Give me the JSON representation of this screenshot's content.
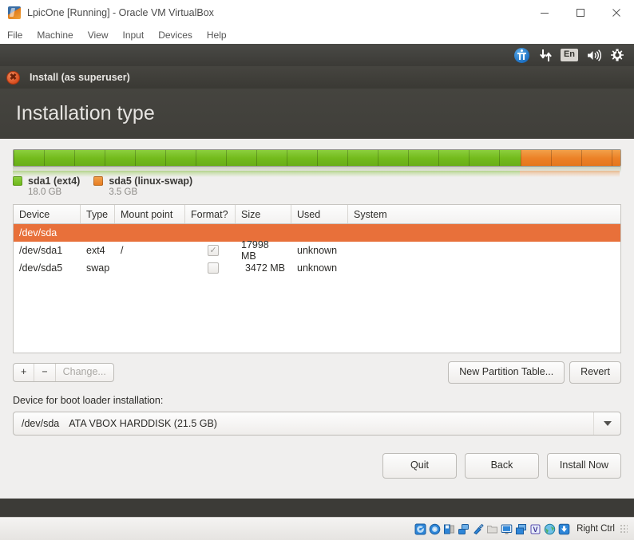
{
  "vbox_window": {
    "title": "LpicOne [Running] - Oracle VM VirtualBox",
    "app_icon": "virtualbox-icon",
    "controls": {
      "minimize": "minimize-icon",
      "maximize": "maximize-icon",
      "close": "close-icon"
    },
    "menu": [
      {
        "label": "File"
      },
      {
        "label": "Machine"
      },
      {
        "label": "View"
      },
      {
        "label": "Input"
      },
      {
        "label": "Devices"
      },
      {
        "label": "Help"
      }
    ]
  },
  "ubuntu_panel": {
    "tray": [
      {
        "name": "accessibility-icon"
      },
      {
        "name": "network-icon"
      },
      {
        "name": "keyboard-layout-indicator",
        "label": "En"
      },
      {
        "name": "volume-icon"
      },
      {
        "name": "system-settings-gear-icon"
      }
    ]
  },
  "installer": {
    "window_title": "Install (as superuser)",
    "close_icon": "close-icon",
    "heading": "Installation type",
    "partition_bar": {
      "segments": [
        {
          "name": "sda1",
          "color": "#73bb1c",
          "percent": 83.5
        },
        {
          "name": "sda5",
          "color": "#ec8126",
          "percent": 16.5
        }
      ]
    },
    "legend": [
      {
        "label": "sda1 (ext4)",
        "size": "18.0 GB",
        "color": "#73bb1c"
      },
      {
        "label": "sda5 (linux-swap)",
        "size": "3.5 GB",
        "color": "#ec8126"
      }
    ],
    "table": {
      "columns": [
        "Device",
        "Type",
        "Mount point",
        "Format?",
        "Size",
        "Used",
        "System"
      ],
      "rows": [
        {
          "selected": true,
          "device": "/dev/sda",
          "type": "",
          "mount": "",
          "format": null,
          "size": "",
          "used": "",
          "system": ""
        },
        {
          "selected": false,
          "device": "/dev/sda1",
          "type": "ext4",
          "mount": "/",
          "format": true,
          "size": "17998 MB",
          "used": "unknown",
          "system": ""
        },
        {
          "selected": false,
          "device": "/dev/sda5",
          "type": "swap",
          "mount": "",
          "format": false,
          "size": "3472 MB",
          "used": "unknown",
          "system": ""
        }
      ]
    },
    "edit_bar": {
      "add": "+",
      "remove": "−",
      "change": "Change...",
      "new_partition_table": "New Partition Table...",
      "revert": "Revert"
    },
    "boot_loader": {
      "label": "Device for boot loader installation:",
      "selected_device": "/dev/sda",
      "selected_description": "ATA VBOX HARDDISK (21.5 GB)"
    },
    "footer": {
      "quit": "Quit",
      "back": "Back",
      "install_now": "Install Now"
    }
  },
  "status_bar": {
    "icons": [
      {
        "name": "hard-disk-icon"
      },
      {
        "name": "optical-drive-icon"
      },
      {
        "name": "floppy-drive-icon"
      },
      {
        "name": "network-adapter-icon"
      },
      {
        "name": "usb-icon"
      },
      {
        "name": "shared-folders-icon"
      },
      {
        "name": "display-icon"
      },
      {
        "name": "video-capture-icon"
      },
      {
        "name": "guest-additions-icon"
      },
      {
        "name": "remote-desktop-icon"
      },
      {
        "name": "mouse-capture-icon"
      }
    ],
    "host_key": "Right Ctrl"
  }
}
